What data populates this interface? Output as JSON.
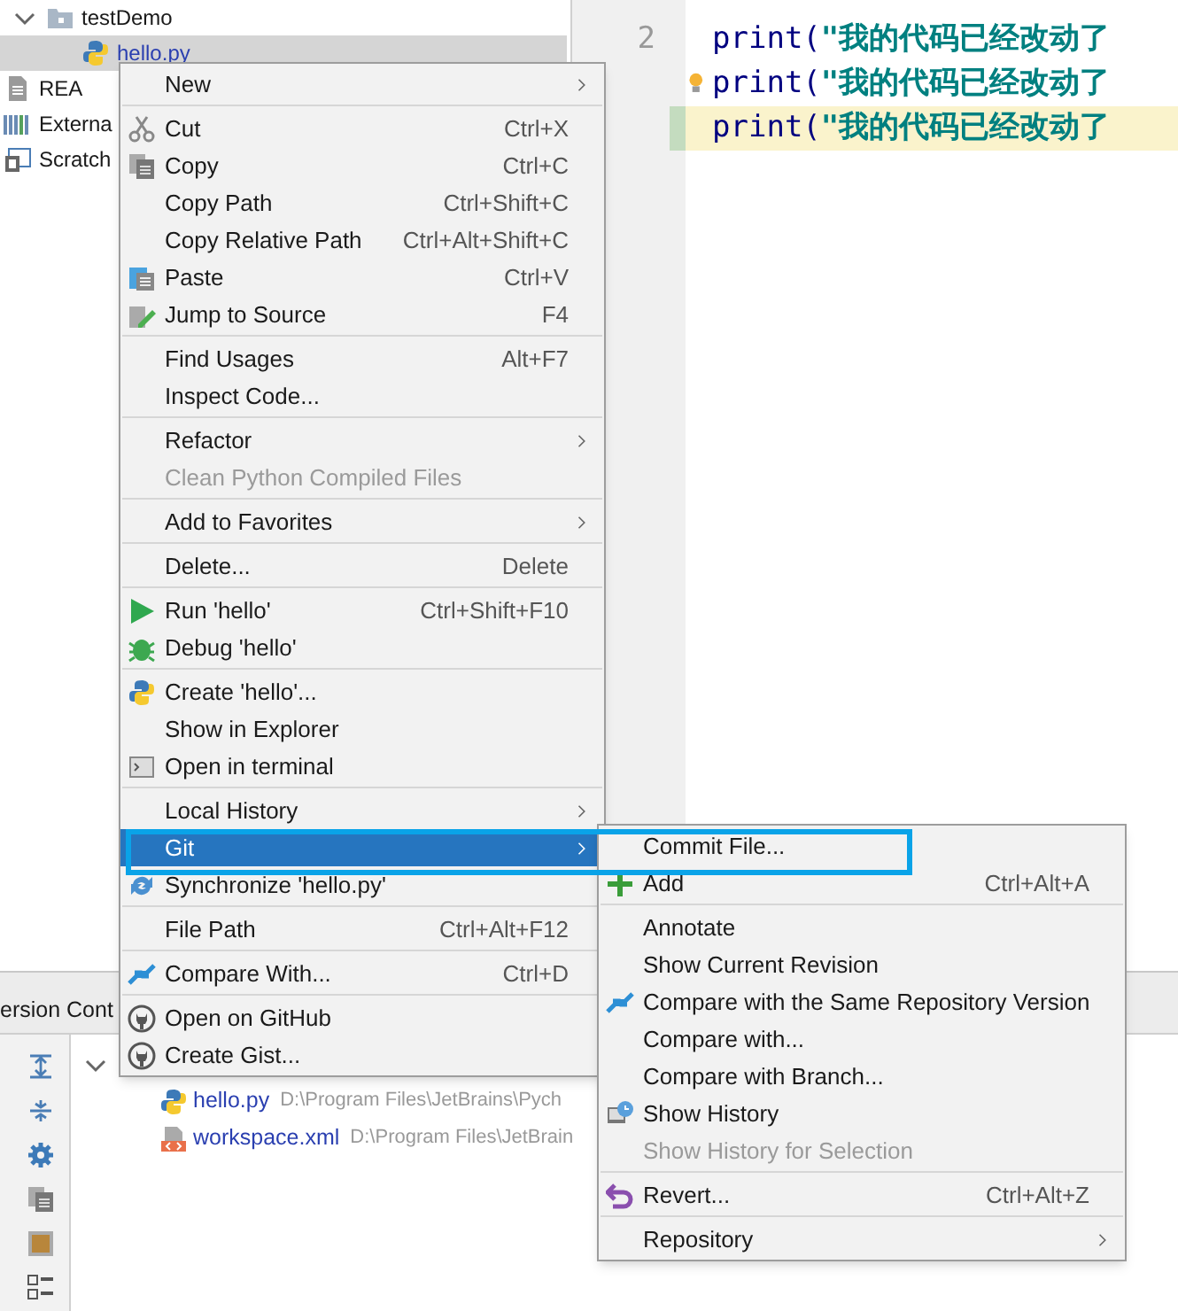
{
  "project_tree": [
    {
      "label": "testDemo",
      "selected": false,
      "modified": false,
      "expanded": true,
      "children": [
        {
          "label": "hello.py",
          "selected": true,
          "modified": true
        }
      ]
    },
    {
      "label": "REA",
      "selected": false,
      "modified": false
    },
    {
      "label": "Externa",
      "selected": false,
      "modified": false
    },
    {
      "label": "Scratch",
      "selected": false,
      "modified": false
    }
  ],
  "editor": {
    "lines": [
      {
        "number": "2",
        "call": "print(",
        "argument": "\"我的代码已经改动了",
        "current": false,
        "changed": false,
        "hint": false
      },
      {
        "call": "print(",
        "argument": "\"我的代码已经改动了",
        "current": false,
        "changed": false,
        "hint": true
      },
      {
        "call": "print(",
        "argument": "\"我的代码已经改动了",
        "current": true,
        "changed": true,
        "hint": false
      }
    ]
  },
  "context_menu": {
    "items": [
      {
        "kind": "item",
        "label": "New",
        "submenu": true,
        "disabled": false,
        "selected": false
      },
      {
        "kind": "separator"
      },
      {
        "kind": "item",
        "label": "Cut",
        "shortcut": "Ctrl+X",
        "submenu": false,
        "disabled": false,
        "selected": false
      },
      {
        "kind": "item",
        "label": "Copy",
        "shortcut": "Ctrl+C",
        "submenu": false,
        "disabled": false,
        "selected": false
      },
      {
        "kind": "item",
        "label": "Copy Path",
        "shortcut": "Ctrl+Shift+C",
        "submenu": false,
        "disabled": false,
        "selected": false
      },
      {
        "kind": "item",
        "label": "Copy Relative Path",
        "shortcut": "Ctrl+Alt+Shift+C",
        "submenu": false,
        "disabled": false,
        "selected": false
      },
      {
        "kind": "item",
        "label": "Paste",
        "shortcut": "Ctrl+V",
        "submenu": false,
        "disabled": false,
        "selected": false
      },
      {
        "kind": "item",
        "label": "Jump to Source",
        "shortcut": "F4",
        "submenu": false,
        "disabled": false,
        "selected": false
      },
      {
        "kind": "separator"
      },
      {
        "kind": "item",
        "label": "Find Usages",
        "shortcut": "Alt+F7",
        "submenu": false,
        "disabled": false,
        "selected": false
      },
      {
        "kind": "item",
        "label": "Inspect Code...",
        "submenu": false,
        "disabled": false,
        "selected": false
      },
      {
        "kind": "separator"
      },
      {
        "kind": "item",
        "label": "Refactor",
        "submenu": true,
        "disabled": false,
        "selected": false
      },
      {
        "kind": "item",
        "label": "Clean Python Compiled Files",
        "submenu": false,
        "disabled": true,
        "selected": false
      },
      {
        "kind": "separator"
      },
      {
        "kind": "item",
        "label": "Add to Favorites",
        "submenu": true,
        "disabled": false,
        "selected": false
      },
      {
        "kind": "separator"
      },
      {
        "kind": "item",
        "label": "Delete...",
        "shortcut": "Delete",
        "submenu": false,
        "disabled": false,
        "selected": false
      },
      {
        "kind": "separator"
      },
      {
        "kind": "item",
        "label": "Run 'hello'",
        "shortcut": "Ctrl+Shift+F10",
        "submenu": false,
        "disabled": false,
        "selected": false
      },
      {
        "kind": "item",
        "label": "Debug 'hello'",
        "submenu": false,
        "disabled": false,
        "selected": false
      },
      {
        "kind": "separator"
      },
      {
        "kind": "item",
        "label": "Create 'hello'...",
        "submenu": false,
        "disabled": false,
        "selected": false
      },
      {
        "kind": "item",
        "label": "Show in Explorer",
        "submenu": false,
        "disabled": false,
        "selected": false
      },
      {
        "kind": "item",
        "label": "Open in terminal",
        "submenu": false,
        "disabled": false,
        "selected": false
      },
      {
        "kind": "separator"
      },
      {
        "kind": "item",
        "label": "Local History",
        "submenu": true,
        "disabled": false,
        "selected": false
      },
      {
        "kind": "item",
        "label": "Git",
        "submenu": true,
        "disabled": false,
        "selected": true
      },
      {
        "kind": "item",
        "label": "Synchronize 'hello.py'",
        "submenu": false,
        "disabled": false,
        "selected": false
      },
      {
        "kind": "separator"
      },
      {
        "kind": "item",
        "label": "File Path",
        "shortcut": "Ctrl+Alt+F12",
        "submenu": false,
        "disabled": false,
        "selected": false
      },
      {
        "kind": "separator"
      },
      {
        "kind": "item",
        "label": "Compare With...",
        "shortcut": "Ctrl+D",
        "submenu": false,
        "disabled": false,
        "selected": false
      },
      {
        "kind": "separator"
      },
      {
        "kind": "item",
        "label": "Open on GitHub",
        "submenu": false,
        "disabled": false,
        "selected": false
      },
      {
        "kind": "item",
        "label": "Create Gist...",
        "submenu": false,
        "disabled": false,
        "selected": false
      }
    ]
  },
  "git_submenu": {
    "items": [
      {
        "kind": "item",
        "label": "Commit File...",
        "submenu": false,
        "disabled": false,
        "selected": false
      },
      {
        "kind": "item",
        "label": "Add",
        "shortcut": "Ctrl+Alt+A",
        "submenu": false,
        "disabled": false,
        "selected": false
      },
      {
        "kind": "separator"
      },
      {
        "kind": "item",
        "label": "Annotate",
        "submenu": false,
        "disabled": false,
        "selected": false
      },
      {
        "kind": "item",
        "label": "Show Current Revision",
        "submenu": false,
        "disabled": false,
        "selected": false
      },
      {
        "kind": "item",
        "label": "Compare with the Same Repository Version",
        "submenu": false,
        "disabled": false,
        "selected": false
      },
      {
        "kind": "item",
        "label": "Compare with...",
        "submenu": false,
        "disabled": false,
        "selected": false
      },
      {
        "kind": "item",
        "label": "Compare with Branch...",
        "submenu": false,
        "disabled": false,
        "selected": false
      },
      {
        "kind": "item",
        "label": "Show History",
        "submenu": false,
        "disabled": false,
        "selected": false
      },
      {
        "kind": "item",
        "label": "Show History for Selection",
        "submenu": false,
        "disabled": true,
        "selected": false
      },
      {
        "kind": "separator"
      },
      {
        "kind": "item",
        "label": "Revert...",
        "shortcut": "Ctrl+Alt+Z",
        "submenu": false,
        "disabled": false,
        "selected": false
      },
      {
        "kind": "separator"
      },
      {
        "kind": "item",
        "label": "Repository",
        "submenu": true,
        "disabled": false,
        "selected": false
      }
    ]
  },
  "version_control": {
    "title": "ersion Cont",
    "group_expanded": true,
    "changes": [
      {
        "name": "hello.py",
        "path": "D:\\Program Files\\JetBrains\\Pych"
      },
      {
        "name": "workspace.xml",
        "path": "D:\\Program Files\\JetBrain"
      }
    ]
  }
}
